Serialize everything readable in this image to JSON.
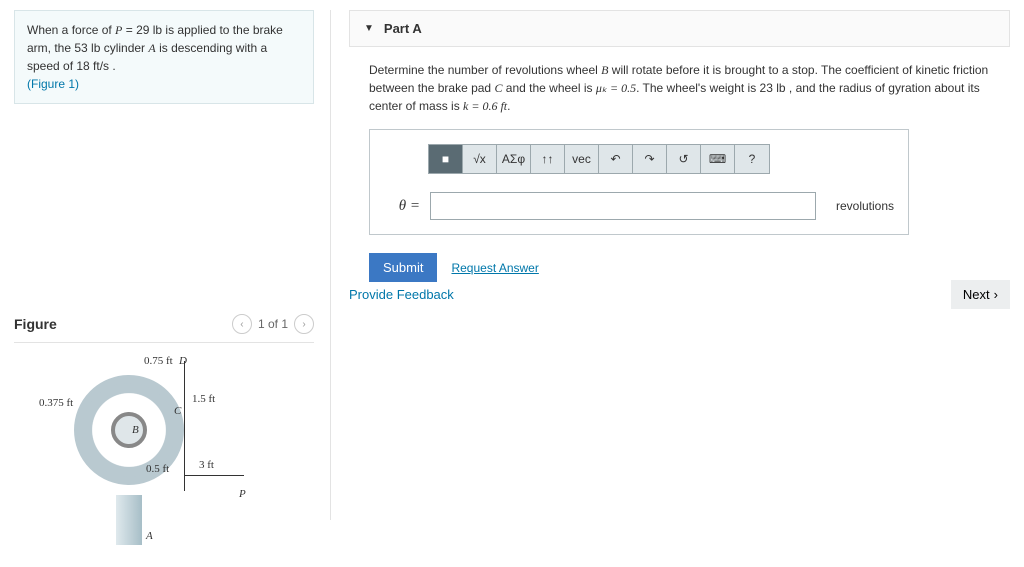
{
  "problem": {
    "line1_pre": "When a force of ",
    "p_var": "P",
    "p_eq": " = 29 lb",
    "line1_post": " is applied to the brake arm, the 53 lb cylinder ",
    "a_var": "A",
    "line1_end": " is descending with a speed of 18 ft/s .",
    "figlink": "(Figure 1)"
  },
  "figure": {
    "title": "Figure",
    "nav": "1 of 1",
    "dims": {
      "d075": "0.75 ft",
      "d15": "1.5 ft",
      "d0375": "0.375 ft",
      "d05": "0.5 ft",
      "d3": "3 ft",
      "labelA": "A",
      "labelB": "B",
      "labelC": "C",
      "labelD": "D",
      "labelP": "P"
    }
  },
  "right": {
    "part_label": "Part A",
    "instr_pre": "Determine the number of revolutions wheel ",
    "b_var": "B",
    "instr_mid": " will rotate before it is brought to a stop. The coefficient of kinetic friction between the brake pad ",
    "c_var": "C",
    "instr_mid2": " and the wheel is ",
    "mu": "μₖ = 0.5",
    "instr_mid3": ". The wheel's weight is 23 lb , and the radius of gyration about its center of mass is ",
    "k": "k = 0.6 ft",
    "instr_end": ".",
    "toolbar": {
      "sq": "■",
      "root": "√x",
      "greek": "ΑΣφ",
      "arrows": "↑↑",
      "vec": "vec",
      "undo": "↶",
      "redo": "↷",
      "reset": "↺",
      "kb": "⌨",
      "help": "?"
    },
    "theta": "θ =",
    "unit": "revolutions",
    "submit": "Submit",
    "request": "Request Answer",
    "feedback": "Provide Feedback",
    "next": "Next"
  }
}
